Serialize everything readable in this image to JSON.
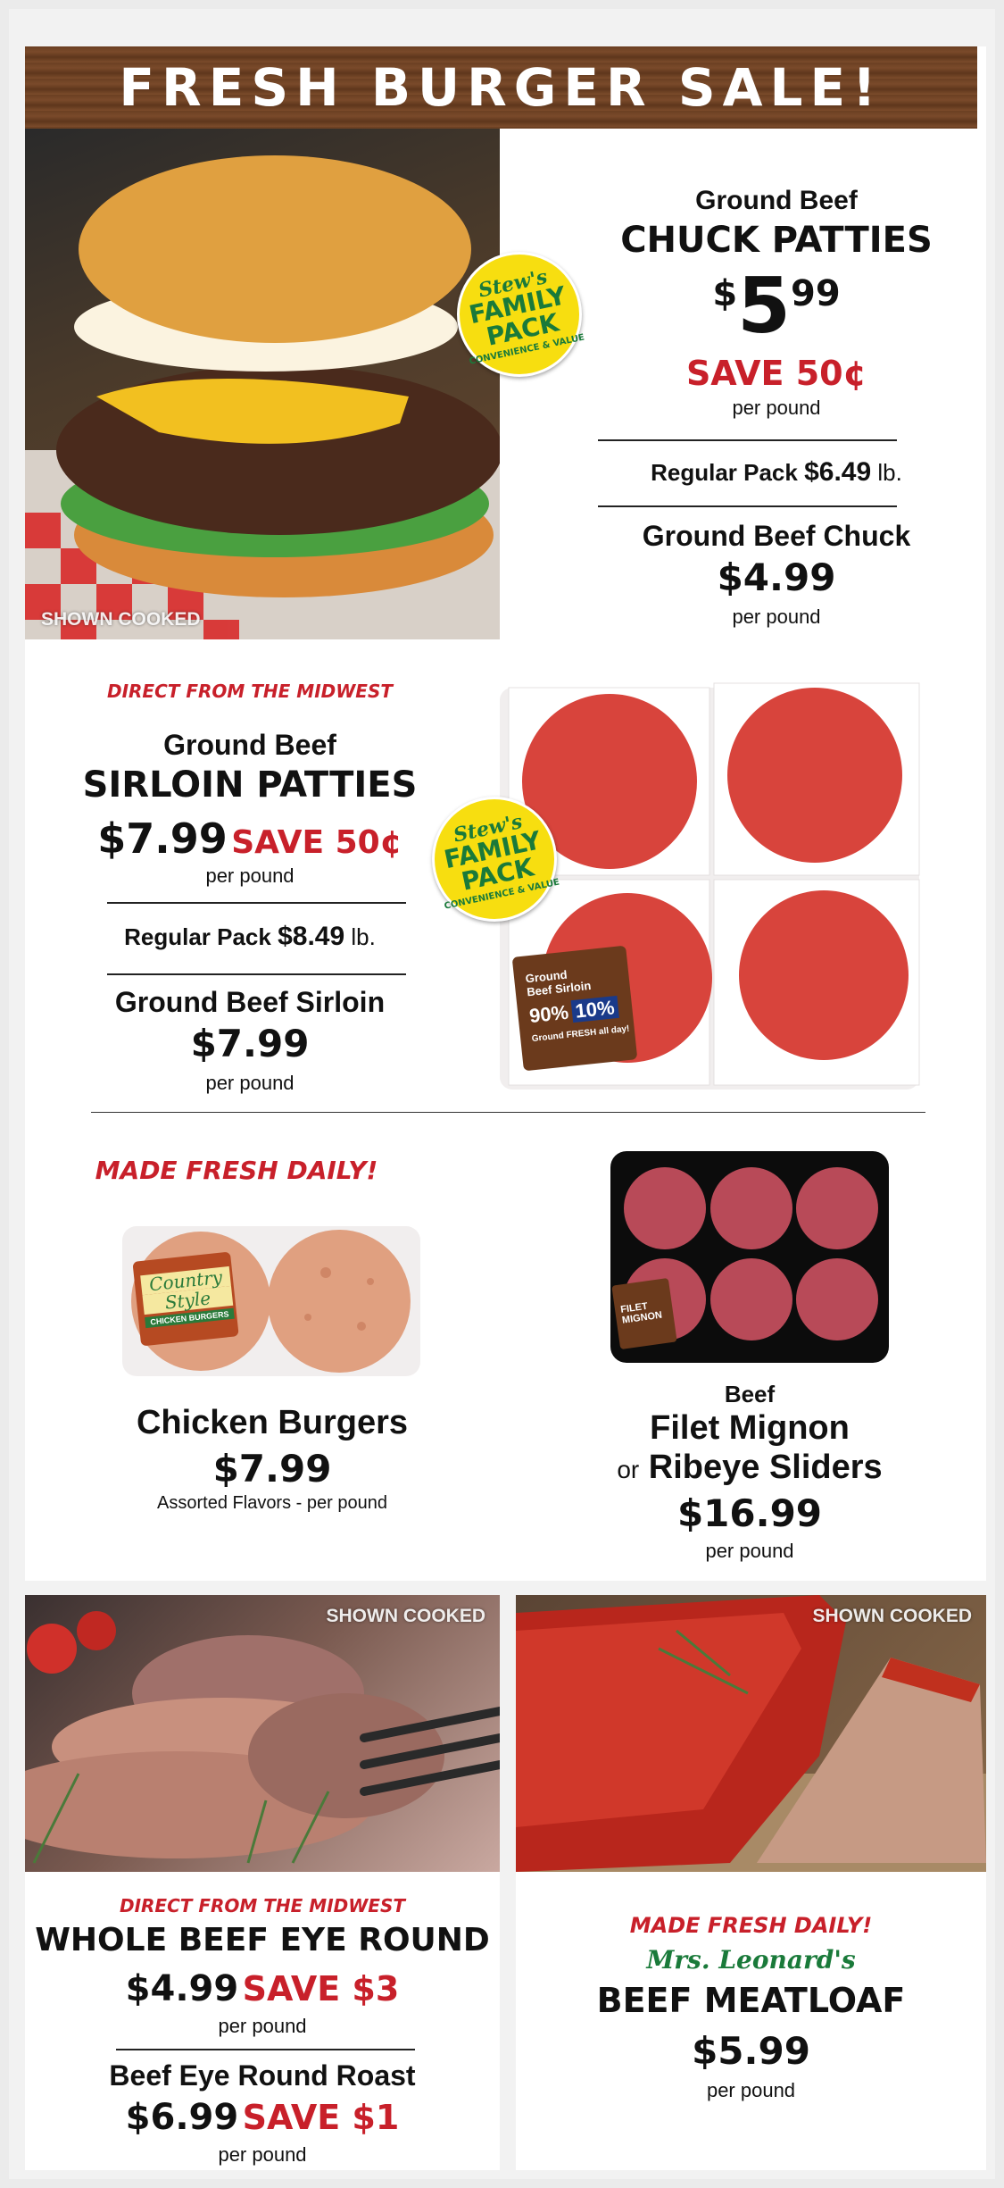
{
  "banner": {
    "title": "FRESH BURGER SALE!"
  },
  "chuck": {
    "photo_tag": "SHOWN COOKED",
    "badge": {
      "line1": "Stew's",
      "line2": "FAMILY",
      "line3": "PACK",
      "line4": "CONVENIENCE & VALUE"
    },
    "subtitle": "Ground Beef",
    "title": "CHUCK PATTIES",
    "price_dollar": "$",
    "price_main": "5",
    "price_cents": "99",
    "save": "SAVE 50¢",
    "unit": "per pound",
    "regular_label": "Regular Pack",
    "regular_price": "$6.49",
    "regular_unit": "lb.",
    "alt_name": "Ground Beef Chuck",
    "alt_price": "$4.99",
    "alt_unit": "per pound"
  },
  "sirloin": {
    "origin": "DIRECT FROM THE MIDWEST",
    "subtitle": "Ground Beef",
    "title": "SIRLOIN PATTIES",
    "price": "$7.99",
    "save": "SAVE 50¢",
    "unit": "per pound",
    "regular_label": "Regular Pack",
    "regular_price": "$8.49",
    "regular_unit": "lb.",
    "alt_name": "Ground Beef Sirloin",
    "alt_price": "$7.99",
    "alt_unit": "per pound",
    "badge": {
      "line1": "Stew's",
      "line2": "FAMILY",
      "line3": "PACK",
      "line4": "CONVENIENCE & VALUE"
    },
    "label": {
      "line1": "Ground",
      "line2": "Beef Sirloin",
      "lean": "90%",
      "fat": "10%",
      "footer": "Ground FRESH all day!"
    }
  },
  "chicken": {
    "tagline": "MADE FRESH DAILY!",
    "name": "Chicken Burgers",
    "price": "$7.99",
    "note": "Assorted Flavors - per pound",
    "label": {
      "line1": "Country",
      "line2": "Style",
      "line3": "CHICKEN BURGERS"
    }
  },
  "sliders": {
    "line1": "Beef",
    "line2": "Filet Mignon",
    "line3_prefix": "or",
    "line3": "Ribeye Sliders",
    "price": "$16.99",
    "unit": "per pound",
    "label": {
      "line1": "FILET",
      "line2": "MIGNON"
    }
  },
  "eyeround": {
    "photo_tag": "SHOWN COOKED",
    "origin": "DIRECT FROM THE MIDWEST",
    "title": "WHOLE BEEF EYE ROUND",
    "price": "$4.99",
    "save": "SAVE $3",
    "unit": "per pound",
    "alt_name": "Beef Eye Round Roast",
    "alt_price": "$6.99",
    "alt_save": "SAVE $1",
    "alt_unit": "per pound"
  },
  "meatloaf": {
    "photo_tag": "SHOWN COOKED",
    "tagline": "MADE FRESH DAILY!",
    "brand": "Mrs. Leonard's",
    "title": "BEEF MEATLOAF",
    "price": "$5.99",
    "unit": "per pound"
  }
}
